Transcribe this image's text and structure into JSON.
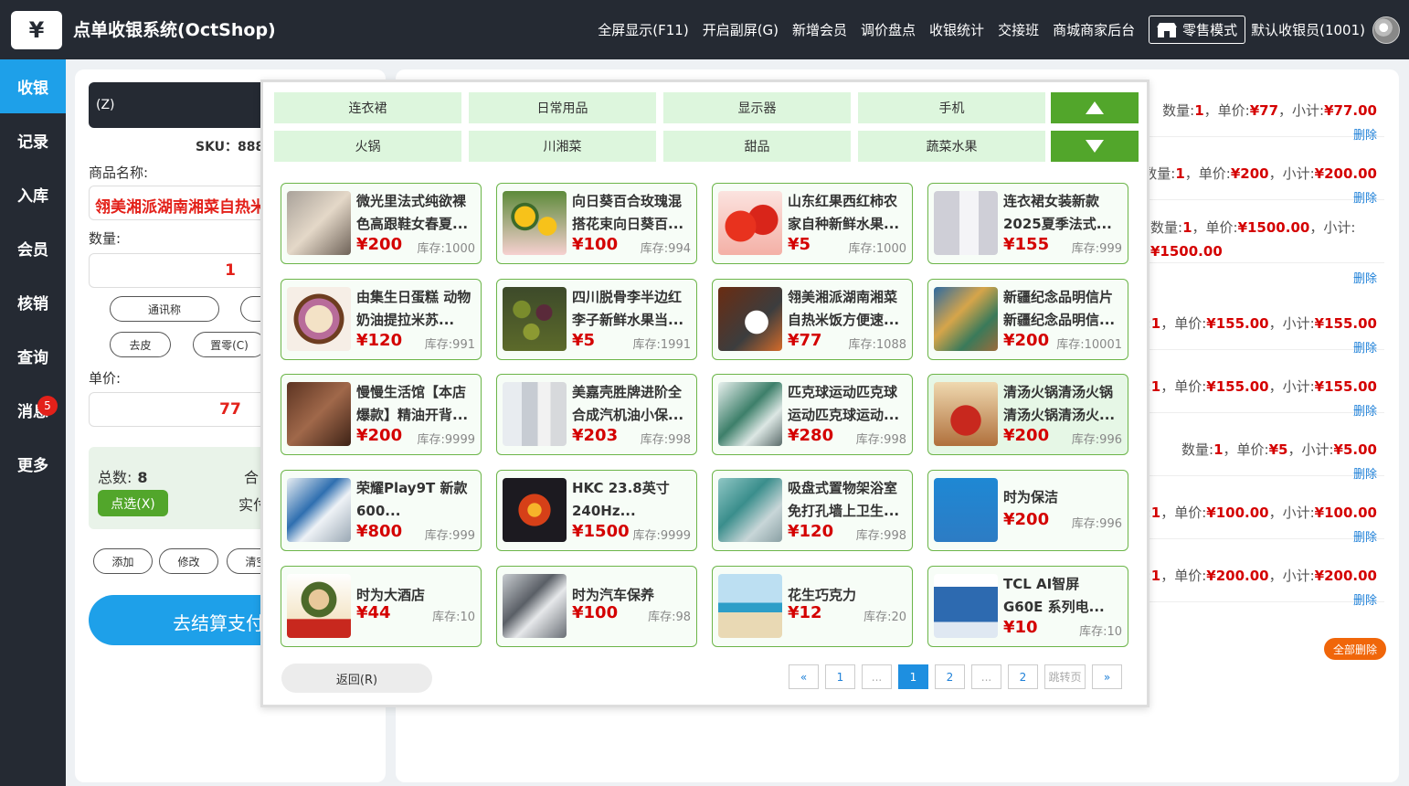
{
  "header": {
    "logo_glyph": "¥",
    "title": "点单收银系统(OctShop)",
    "nav": [
      "全屏显示(F11)",
      "开启副屏(G)",
      "新增会员",
      "调价盘点",
      "收银统计",
      "交接班",
      "商城商家后台"
    ],
    "retail_mode": "零售模式",
    "cashier": "默认收银员(1001)"
  },
  "sidebar": {
    "items": [
      {
        "label": "收银",
        "active": true
      },
      {
        "label": "记录"
      },
      {
        "label": "入库"
      },
      {
        "label": "会员"
      },
      {
        "label": "核销"
      },
      {
        "label": "查询"
      },
      {
        "label": "消息",
        "badge": "5"
      },
      {
        "label": "更多"
      }
    ]
  },
  "left": {
    "scan_placeholder": "(Z)",
    "sku": "SKU：888",
    "name_label": "商品名称:",
    "name_value": "翎美湘派湖南湘菜自热米饭方便速食",
    "qty_label": "数量:",
    "qty_value": "1",
    "btn_alias": "通讯称",
    "btn_tare": "去皮",
    "btn_zero": "置零(C)",
    "price_label": "单价:",
    "price_value": "77",
    "total_label": "总数:",
    "total_value": "8",
    "select_btn": "点选(X)",
    "sum_partial_1": "合",
    "sum_partial_2": "实付",
    "btn_add": "添加",
    "btn_edit": "修改",
    "btn_clear": "清空",
    "pay_btn": "去结算支付"
  },
  "orders": [
    {
      "qty": "1",
      "price": "¥77",
      "subtotal": "¥77.00",
      "del": "删除"
    },
    {
      "qty": "1",
      "price": "¥200",
      "subtotal": "¥200.00",
      "del": "删除"
    },
    {
      "qty": "1",
      "price": "¥1500.00",
      "subtotal": "¥1500.00",
      "del": "删除"
    },
    {
      "qty": "1",
      "price": "¥155.00",
      "subtotal": "¥155.00",
      "del": "删除"
    },
    {
      "qty": "1",
      "price": "¥155.00",
      "subtotal": "¥155.00",
      "del": "删除"
    },
    {
      "qty": "1",
      "price": "¥5",
      "subtotal": "¥5.00",
      "del": "删除"
    },
    {
      "qty": "1",
      "price": "¥100.00",
      "subtotal": "¥100.00",
      "del": "删除"
    },
    {
      "qty": "1",
      "price": "¥200.00",
      "subtotal": "¥200.00",
      "del": "删除"
    }
  ],
  "order_labels": {
    "qty": "数量:",
    "price": "单价:",
    "subtotal": "小计:"
  },
  "delete_all": "全部删除",
  "popup": {
    "categories": [
      "连衣裙",
      "日常用品",
      "显示器",
      "手机",
      "火锅",
      "川湘菜",
      "甜品",
      "蔬菜水果"
    ],
    "products": [
      {
        "name": "微光里法式纯欲裸色高跟鞋女春夏...",
        "price": "¥200",
        "stock": "库存:1000",
        "img": "shoes"
      },
      {
        "name": "向日葵百合玫瑰混搭花束向日葵百...",
        "price": "¥100",
        "stock": "库存:994",
        "img": "flower"
      },
      {
        "name": "山东红果西红柿农家自种新鲜水果...",
        "price": "¥5",
        "stock": "库存:1000",
        "img": "tomato"
      },
      {
        "name": "连衣裙女装新款2025夏季法式...",
        "price": "¥155",
        "stock": "库存:999",
        "img": "dress"
      },
      {
        "name": "由集生日蛋糕 动物奶油提拉米苏...",
        "price": "¥120",
        "stock": "库存:991",
        "img": "cake"
      },
      {
        "name": "四川脱骨李半边红李子新鲜水果当...",
        "price": "¥5",
        "stock": "库存:1991",
        "img": "plum"
      },
      {
        "name": "翎美湘派湖南湘菜自热米饭方便速...",
        "price": "¥77",
        "stock": "库存:1088",
        "img": "rice"
      },
      {
        "name": "新疆纪念品明信片新疆纪念品明信...",
        "price": "¥200",
        "stock": "库存:10001",
        "img": "postcard"
      },
      {
        "name": "慢慢生活馆【本店爆款】精油开背...",
        "price": "¥200",
        "stock": "库存:9999",
        "img": "spa"
      },
      {
        "name": "美嘉壳胜牌进阶全合成汽机油小保...",
        "price": "¥203",
        "stock": "库存:998",
        "img": "oil"
      },
      {
        "name": "匹克球运动匹克球运动匹克球运动...",
        "price": "¥280",
        "stock": "库存:998",
        "img": "sport"
      },
      {
        "name": "清汤火锅清汤火锅清汤火锅清汤火...",
        "price": "¥200",
        "stock": "库存:996",
        "img": "hotpot",
        "highlight": true
      },
      {
        "name": "荣耀Play9T 新款600...",
        "price": "¥800",
        "stock": "库存:999",
        "img": "phone"
      },
      {
        "name": "HKC 23.8英寸240Hz...",
        "price": "¥1500",
        "stock": "库存:9999",
        "img": "monitor"
      },
      {
        "name": "吸盘式置物架浴室免打孔墙上卫生...",
        "price": "¥120",
        "stock": "库存:998",
        "img": "rack"
      },
      {
        "name": "时为保洁",
        "price": "¥200",
        "stock": "库存:996",
        "img": "clean",
        "one_line": true
      },
      {
        "name": "时为大酒店",
        "price": "¥44",
        "stock": "库存:10",
        "img": "hotel",
        "one_line": true
      },
      {
        "name": "时为汽车保养",
        "price": "¥100",
        "stock": "库存:98",
        "img": "car",
        "one_line": true
      },
      {
        "name": "花生巧克力",
        "price": "¥12",
        "stock": "库存:20",
        "img": "beach",
        "one_line": true
      },
      {
        "name": "TCL AI智屏 G60E 系列电...",
        "price": "¥10",
        "stock": "库存:10",
        "img": "tv"
      }
    ],
    "back_btn": "返回(R)",
    "pager": [
      "«",
      "1",
      "...",
      "1",
      "2",
      "...",
      "2",
      "跳转页",
      "»"
    ],
    "pager_active_index": 3
  },
  "colors": {
    "dark": "#252a33",
    "blue": "#1ea0e9",
    "green": "#52a62b",
    "red": "#d40000",
    "orange": "#f0660a"
  }
}
